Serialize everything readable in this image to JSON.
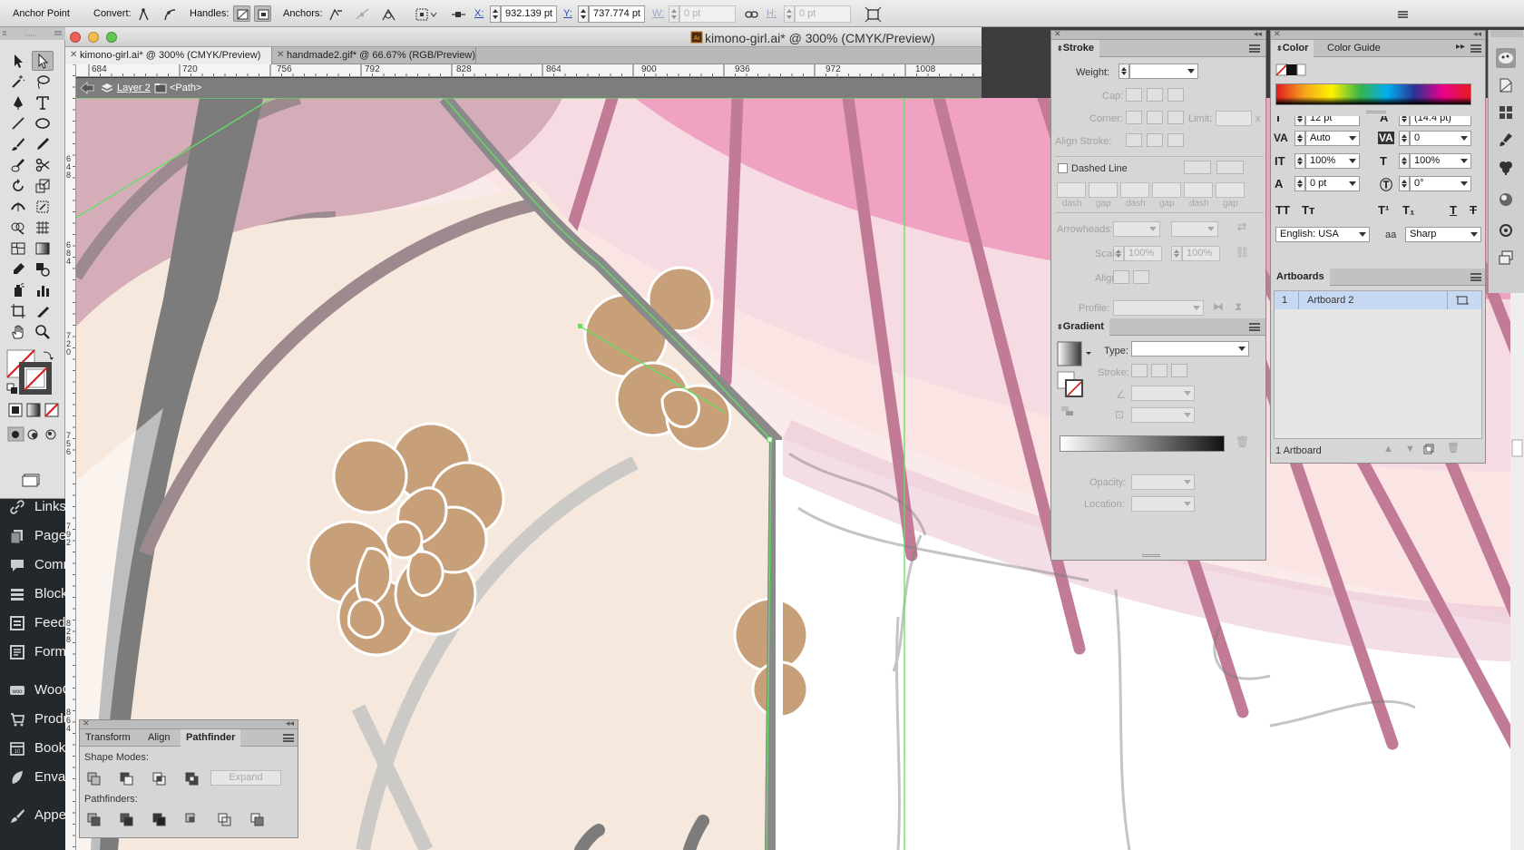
{
  "control_bar": {
    "tool_name": "Anchor Point",
    "convert_label": "Convert:",
    "handles_label": "Handles:",
    "anchors_label": "Anchors:",
    "x_label": "X:",
    "x_value": "932.139 pt",
    "y_label": "Y:",
    "y_value": "737.774 pt",
    "w_label": "W:",
    "w_value": "0 pt",
    "h_label": "H:",
    "h_value": "0 pt"
  },
  "document": {
    "window_title": "kimono-girl.ai* @ 300% (CMYK/Preview)",
    "tabs": [
      {
        "label": "kimono-girl.ai* @ 300% (CMYK/Preview)",
        "active": true
      },
      {
        "label": "handmade2.gif* @ 66.67% (RGB/Preview)",
        "active": false
      }
    ],
    "ruler_h": [
      "684",
      "720",
      "756",
      "792",
      "828",
      "864",
      "900",
      "936",
      "972",
      "1008"
    ],
    "ruler_v": [
      "648",
      "684",
      "720",
      "756",
      "792",
      "828",
      "864"
    ],
    "breadcrumb": {
      "layer": "Layer 2",
      "object": "<Path>"
    }
  },
  "wp_sidebar": {
    "items": [
      "Links",
      "Pages",
      "Comments",
      "Blocks",
      "Feedback",
      "Forms",
      "WooCommerce",
      "Products",
      "Bookings",
      "Envato",
      "Appearance"
    ]
  },
  "stroke_panel": {
    "title": "Stroke",
    "weight_label": "Weight:",
    "cap_label": "Cap:",
    "corner_label": "Corner:",
    "limit_label": "Limit:",
    "limit_suffix": "x",
    "align_stroke_label": "Align Stroke:",
    "dashed_line_label": "Dashed Line",
    "dash_labels": [
      "dash",
      "gap",
      "dash",
      "gap",
      "dash",
      "gap"
    ],
    "arrowheads_label": "Arrowheads:",
    "scale_label": "Scale:",
    "scale_values": [
      "100%",
      "100%"
    ],
    "align_label": "Align:",
    "profile_label": "Profile:"
  },
  "gradient_panel": {
    "title": "Gradient",
    "type_label": "Type:",
    "stroke_label": "Stroke:",
    "opacity_label": "Opacity:",
    "location_label": "Location:"
  },
  "color_panel": {
    "tabs": [
      "Color",
      "Color Guide"
    ]
  },
  "character_panel": {
    "font_size": "12 pt",
    "leading": "(14.4 pt)",
    "kerning": "Auto",
    "tracking": "0",
    "vertical_scale": "100%",
    "horizontal_scale": "100%",
    "baseline_shift": "0 pt",
    "rotation": "0°",
    "caps_buttons": [
      "TT",
      "Tт",
      "T¹",
      "T₁",
      "T",
      "T"
    ],
    "language": "English: USA",
    "antialias_icon": "aa",
    "antialias": "Sharp"
  },
  "artboards_panel": {
    "title": "Artboards",
    "rows": [
      {
        "index": "1",
        "name": "Artboard 2"
      }
    ],
    "footer": "1 Artboard"
  },
  "pathfinder_panel": {
    "tabs": [
      "Transform",
      "Align",
      "Pathfinder"
    ],
    "shape_modes_label": "Shape Modes:",
    "expand_label": "Expand",
    "pathfinders_label": "Pathfinders:"
  },
  "colors": {
    "canvas_bg": "#fbe4e4",
    "kimono_cream": "#f6e8dc",
    "flower_tan": "#c7a07a",
    "umbrella_pink": "#f0a2c3",
    "rib_mauve": "#c27b97",
    "selection_green": "#5ee35e",
    "wp_dark": "#23282d"
  }
}
